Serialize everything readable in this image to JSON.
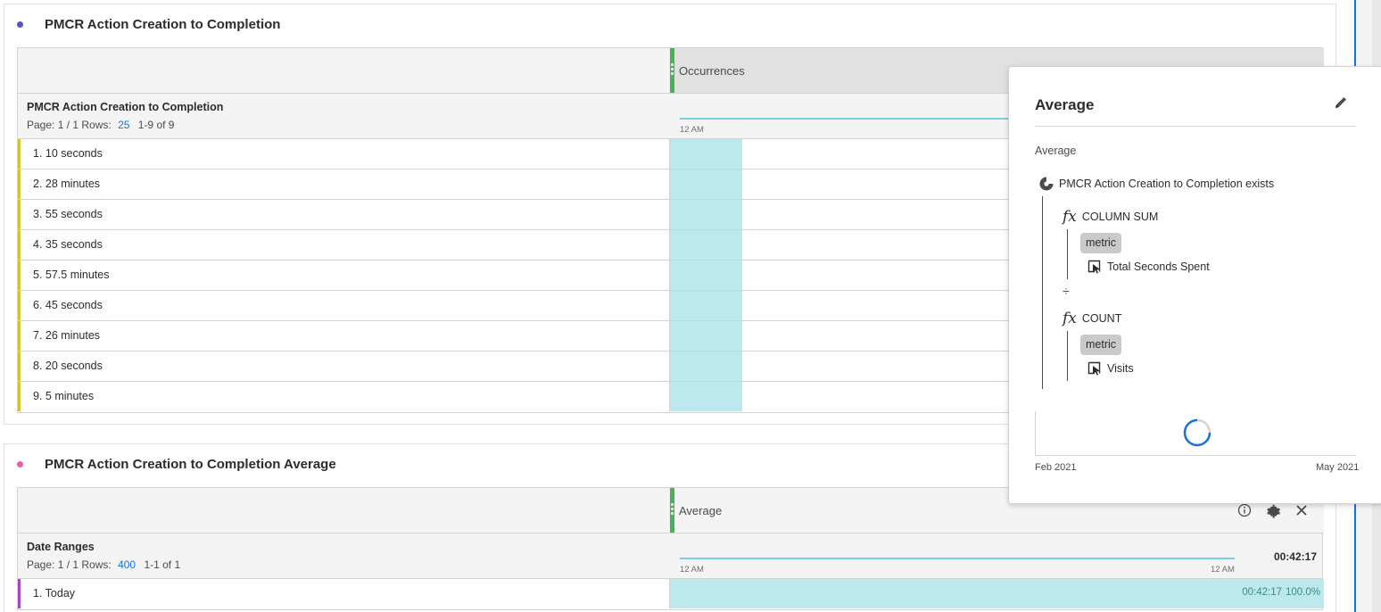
{
  "panel1": {
    "title": "PMCR Action Creation to Completion",
    "dot_color": "#5451c7",
    "metric_header": "Occurrences",
    "dimension_title": "PMCR Action Creation to Completion",
    "page_label": "Page: 1 / 1 Rows:",
    "rows_value": "25",
    "range_label": "1-9 of 9",
    "spark_start": "12 AM",
    "rows": [
      {
        "label": "1. 10 seconds"
      },
      {
        "label": "2. 28 minutes"
      },
      {
        "label": "3. 55 seconds"
      },
      {
        "label": "4. 35 seconds"
      },
      {
        "label": "5. 57.5 minutes"
      },
      {
        "label": "6. 45 seconds"
      },
      {
        "label": "7. 26 minutes"
      },
      {
        "label": "8. 20 seconds"
      },
      {
        "label": "9. 5 minutes"
      }
    ]
  },
  "panel2": {
    "title": "PMCR Action Creation to Completion Average",
    "dot_color": "#e75fa8",
    "metric_header": "Average",
    "dimension_title": "Date Ranges",
    "page_label": "Page: 1 / 1 Rows:",
    "rows_value": "400",
    "range_label": "1-1 of 1",
    "spark_start": "12 AM",
    "spark_end": "12 AM",
    "total": "00:42:17",
    "rows": [
      {
        "label": "1. Today",
        "value": "00:42:17",
        "percent": "100.0%",
        "fill": 1.0
      }
    ]
  },
  "popover": {
    "title": "Average",
    "subtitle": "Average",
    "segment": "PMCR Action Creation to Completion exists",
    "func1": "COLUMN SUM",
    "func1_chip": "metric",
    "func1_metric": "Total Seconds Spent",
    "operator": "÷",
    "func2": "COUNT",
    "func2_chip": "metric",
    "func2_metric": "Visits",
    "date_start": "Feb 2021",
    "date_end": "May 2021"
  },
  "icons": {
    "edit": "pencil-icon",
    "info": "info-icon",
    "settings": "gear-icon",
    "close": "close-icon",
    "segment": "segment-icon",
    "metric": "metric-icon",
    "spinner": "loading-spinner"
  },
  "colors": {
    "accent": "#1473e6",
    "metric_green": "#44b556",
    "bar_fill": "#bde9ec",
    "row_yellow": "#d9c32a",
    "row_purple": "#a546c2"
  }
}
